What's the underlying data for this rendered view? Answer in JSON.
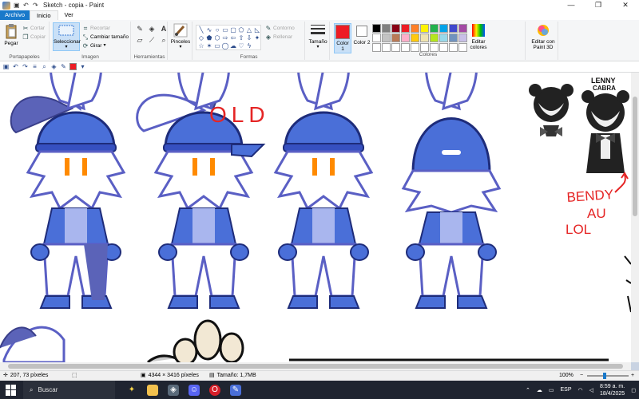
{
  "window": {
    "title": "Sketch - copia - Paint",
    "controls": [
      "—",
      "❐",
      "✕"
    ]
  },
  "menu": {
    "file": "Archivo",
    "tabs": [
      "Inicio",
      "Ver"
    ]
  },
  "ribbon": {
    "clipboard": {
      "paste": "Pegar",
      "cut": "Cortar",
      "copy": "Copiar",
      "label": "Portapapeles"
    },
    "image": {
      "select": "Seleccionar",
      "crop": "Recortar",
      "resize": "Cambiar tamaño",
      "rotate": "Girar",
      "label": "Imagen"
    },
    "tools": {
      "label": "Herramientas"
    },
    "brushes": {
      "label": "Pinceles"
    },
    "shapes": {
      "outline": "Contorno",
      "fill": "Rellenar",
      "label": "Formas"
    },
    "size": {
      "label": "Tamaño"
    },
    "colors": {
      "color1": "Color 1",
      "color2": "Color 2",
      "edit": "Editar colores",
      "paint3d": "Editar con Paint 3D",
      "label": "Colores",
      "color1_value": "#ed1c24",
      "color2_value": "#ffffff",
      "palette": [
        "#000000",
        "#7f7f7f",
        "#880015",
        "#ed1c24",
        "#ff7f27",
        "#fff200",
        "#22b14c",
        "#00a2e8",
        "#3f48cc",
        "#a349a4",
        "#ffffff",
        "#c3c3c3",
        "#b97a57",
        "#ffaec9",
        "#ffc90e",
        "#efe4b0",
        "#b5e61d",
        "#99d9ea",
        "#7092be",
        "#c8bfe7",
        "#ffffff",
        "#ffffff",
        "#ffffff",
        "#ffffff",
        "#ffffff",
        "#ffffff",
        "#ffffff",
        "#ffffff",
        "#ffffff",
        "#ffffff"
      ]
    }
  },
  "canvas": {
    "note_old": "OLD",
    "note_bendy": "BENDY",
    "note_au": "AU",
    "note_lol": "LOL",
    "logo_text_1": "LENNY",
    "logo_text_2": "CABRA",
    "accent_blue": "#4a6fd8",
    "dark_blue": "#1e2c7a",
    "orange": "#ff8a00",
    "red_ink": "#e52525"
  },
  "status": {
    "cursor": "207, 73 píxeles",
    "dimensions": "4344 × 3416 píxeles",
    "filesize": "Tamaño: 1,7MB",
    "zoom": "100%",
    "zoom_level": 0.42
  },
  "taskbar": {
    "search_placeholder": "Buscar",
    "language": "ESP",
    "time": "8:59 a. m.",
    "date": "18/4/2025"
  }
}
